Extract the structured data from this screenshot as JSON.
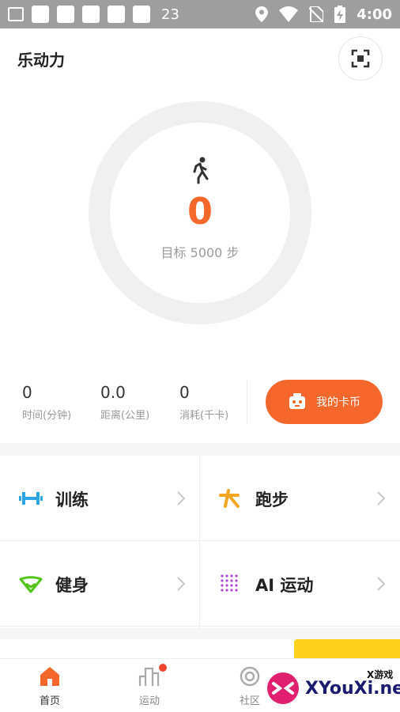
{
  "status_bar": {
    "notification_count": "23",
    "time": "4:00"
  },
  "header": {
    "title": "乐动力"
  },
  "ring": {
    "steps": "0",
    "goal_text": "目标 5000 步"
  },
  "stats": [
    {
      "value": "0",
      "label": "时间(分钟)"
    },
    {
      "value": "0.0",
      "label": "距离(公里)"
    },
    {
      "value": "0",
      "label": "消耗(千卡)"
    }
  ],
  "card_button": {
    "label": "我的卡币"
  },
  "grid": [
    {
      "label": "训练",
      "icon": "dumbbell-icon",
      "color": "#2aa6e6"
    },
    {
      "label": "跑步",
      "icon": "running-icon",
      "color": "#f5a623"
    },
    {
      "label": "健身",
      "icon": "fitness-icon",
      "color": "#52c41a"
    },
    {
      "label": "AI 运动",
      "icon": "ai-dots-icon",
      "color": "#b146d6"
    }
  ],
  "tabs": [
    {
      "label": "首页",
      "icon": "home-icon",
      "active": true
    },
    {
      "label": "运动",
      "icon": "chart-icon",
      "badge": true
    },
    {
      "label": "社区",
      "icon": "community-icon"
    }
  ],
  "watermark": {
    "small": "X游戏",
    "big": "XYouXi.net"
  },
  "colors": {
    "accent": "#f5672a",
    "status_bar": "#9e9e9e"
  }
}
